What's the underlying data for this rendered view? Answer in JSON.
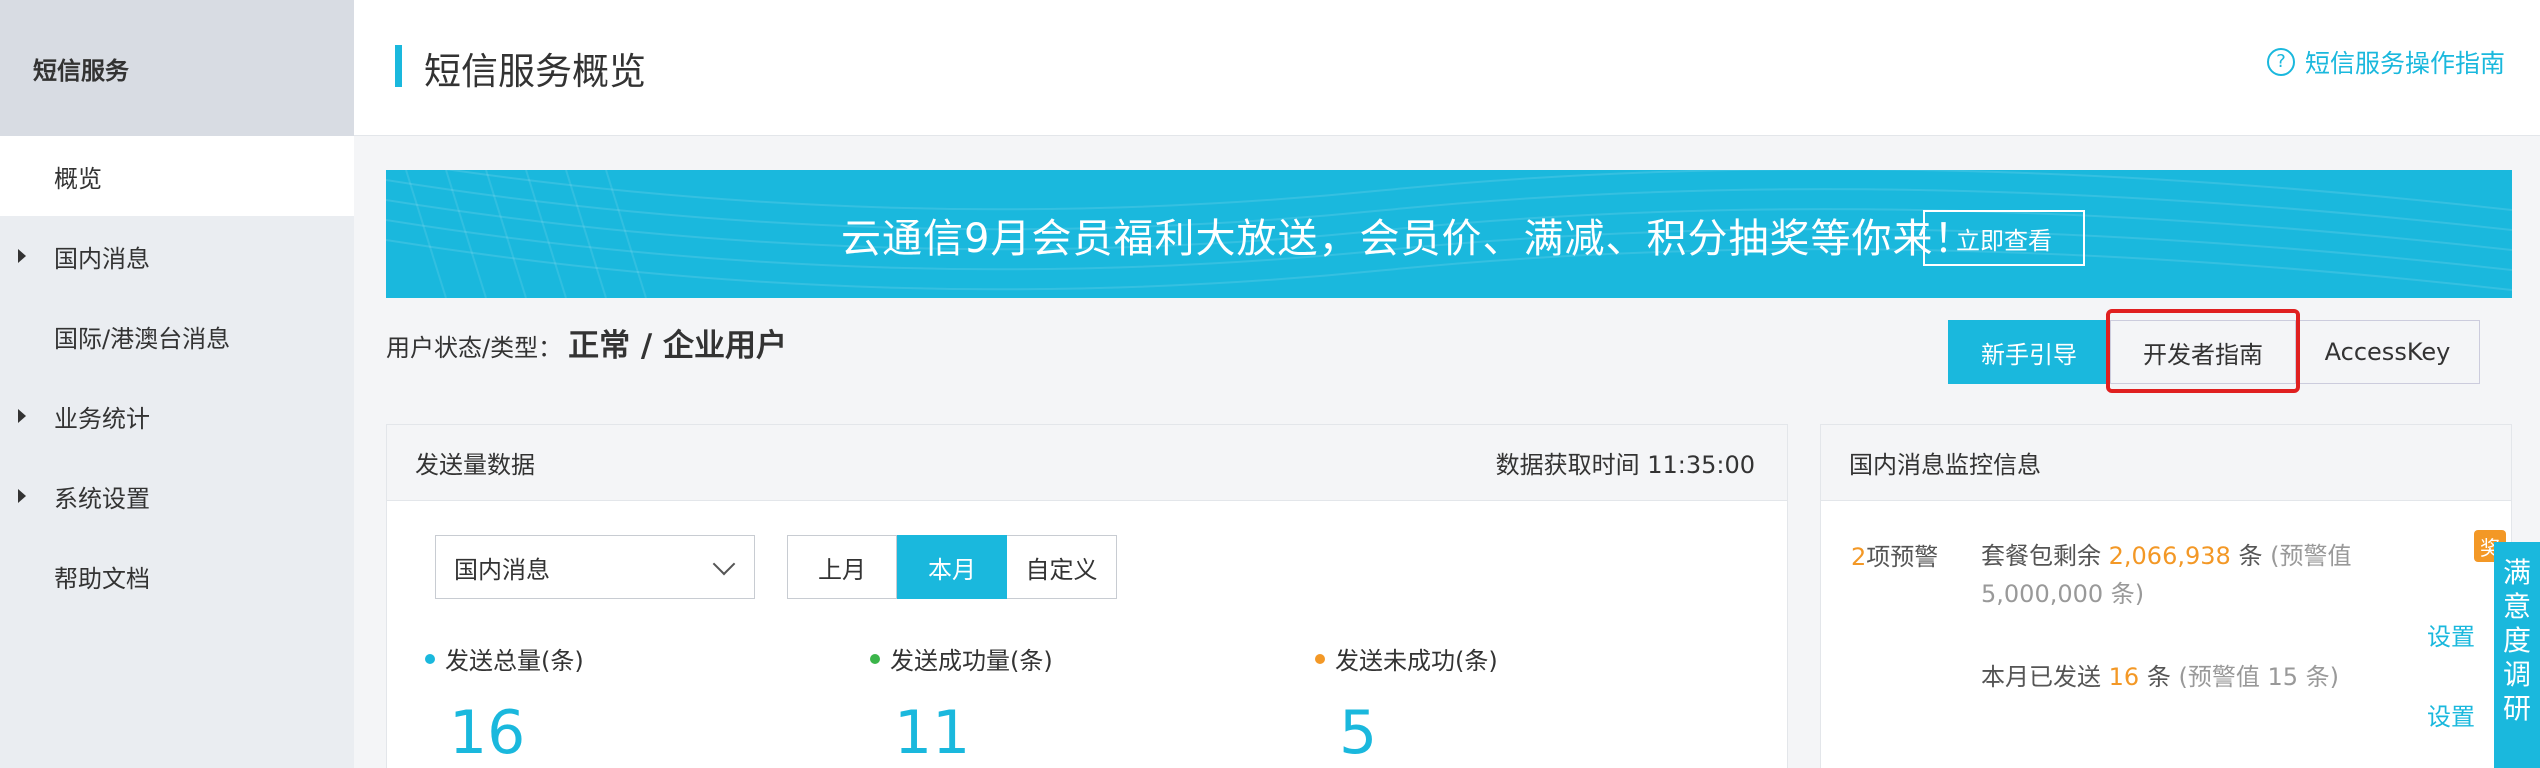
{
  "sidebar": {
    "title": "短信服务",
    "items": [
      {
        "label": "概览",
        "active": true,
        "expandable": false
      },
      {
        "label": "国内消息",
        "active": false,
        "expandable": true
      },
      {
        "label": "国际/港澳台消息",
        "active": false,
        "expandable": false
      },
      {
        "label": "业务统计",
        "active": false,
        "expandable": true
      },
      {
        "label": "系统设置",
        "active": false,
        "expandable": true
      },
      {
        "label": "帮助文档",
        "active": false,
        "expandable": false
      }
    ]
  },
  "header": {
    "title": "短信服务概览",
    "guide_link": "短信服务操作指南",
    "guide_icon": "?"
  },
  "banner": {
    "text": "云通信9月会员福利大放送，会员价、满减、积分抽奖等你来！",
    "button": "立即查看"
  },
  "user_status": {
    "label": "用户状态/类型：",
    "value": "正常 / 企业用户"
  },
  "actions": {
    "newbie_guide": "新手引导",
    "dev_guide": "开发者指南",
    "access_key": "AccessKey"
  },
  "send_panel": {
    "title": "发送量数据",
    "fetch_time": "数据获取时间 11:35:00",
    "select_value": "国内消息",
    "periods": [
      "上月",
      "本月",
      "自定义"
    ],
    "selected_period": "本月",
    "stats": [
      {
        "label": "发送总量(条)",
        "value": "16",
        "color": "#1ab8dd"
      },
      {
        "label": "发送成功量(条)",
        "value": "11",
        "color": "#3bb54a"
      },
      {
        "label": "发送未成功(条)",
        "value": "5",
        "color": "#f39826"
      }
    ]
  },
  "monitor_panel": {
    "title": "国内消息监控信息",
    "warn_count": "2",
    "warn_suffix": "项预警",
    "package_prefix": "套餐包剩余",
    "package_value": "2,066,938",
    "package_unit": "条",
    "package_threshold": "(预警值 5,000,000",
    "package_threshold_end": "条)",
    "set_label_1": "设置",
    "month_prefix": "本月已发送",
    "month_value": "16",
    "month_unit": "条",
    "month_threshold": "(预警值 15 条)",
    "set_label_2": "设置"
  },
  "floating": {
    "award": "奖",
    "survey": [
      "满",
      "意",
      "度",
      "调",
      "研"
    ]
  },
  "colors": {
    "accent": "#1ab8dd",
    "warning": "#f39826",
    "success": "#3bb54a",
    "highlight": "#e02020"
  }
}
